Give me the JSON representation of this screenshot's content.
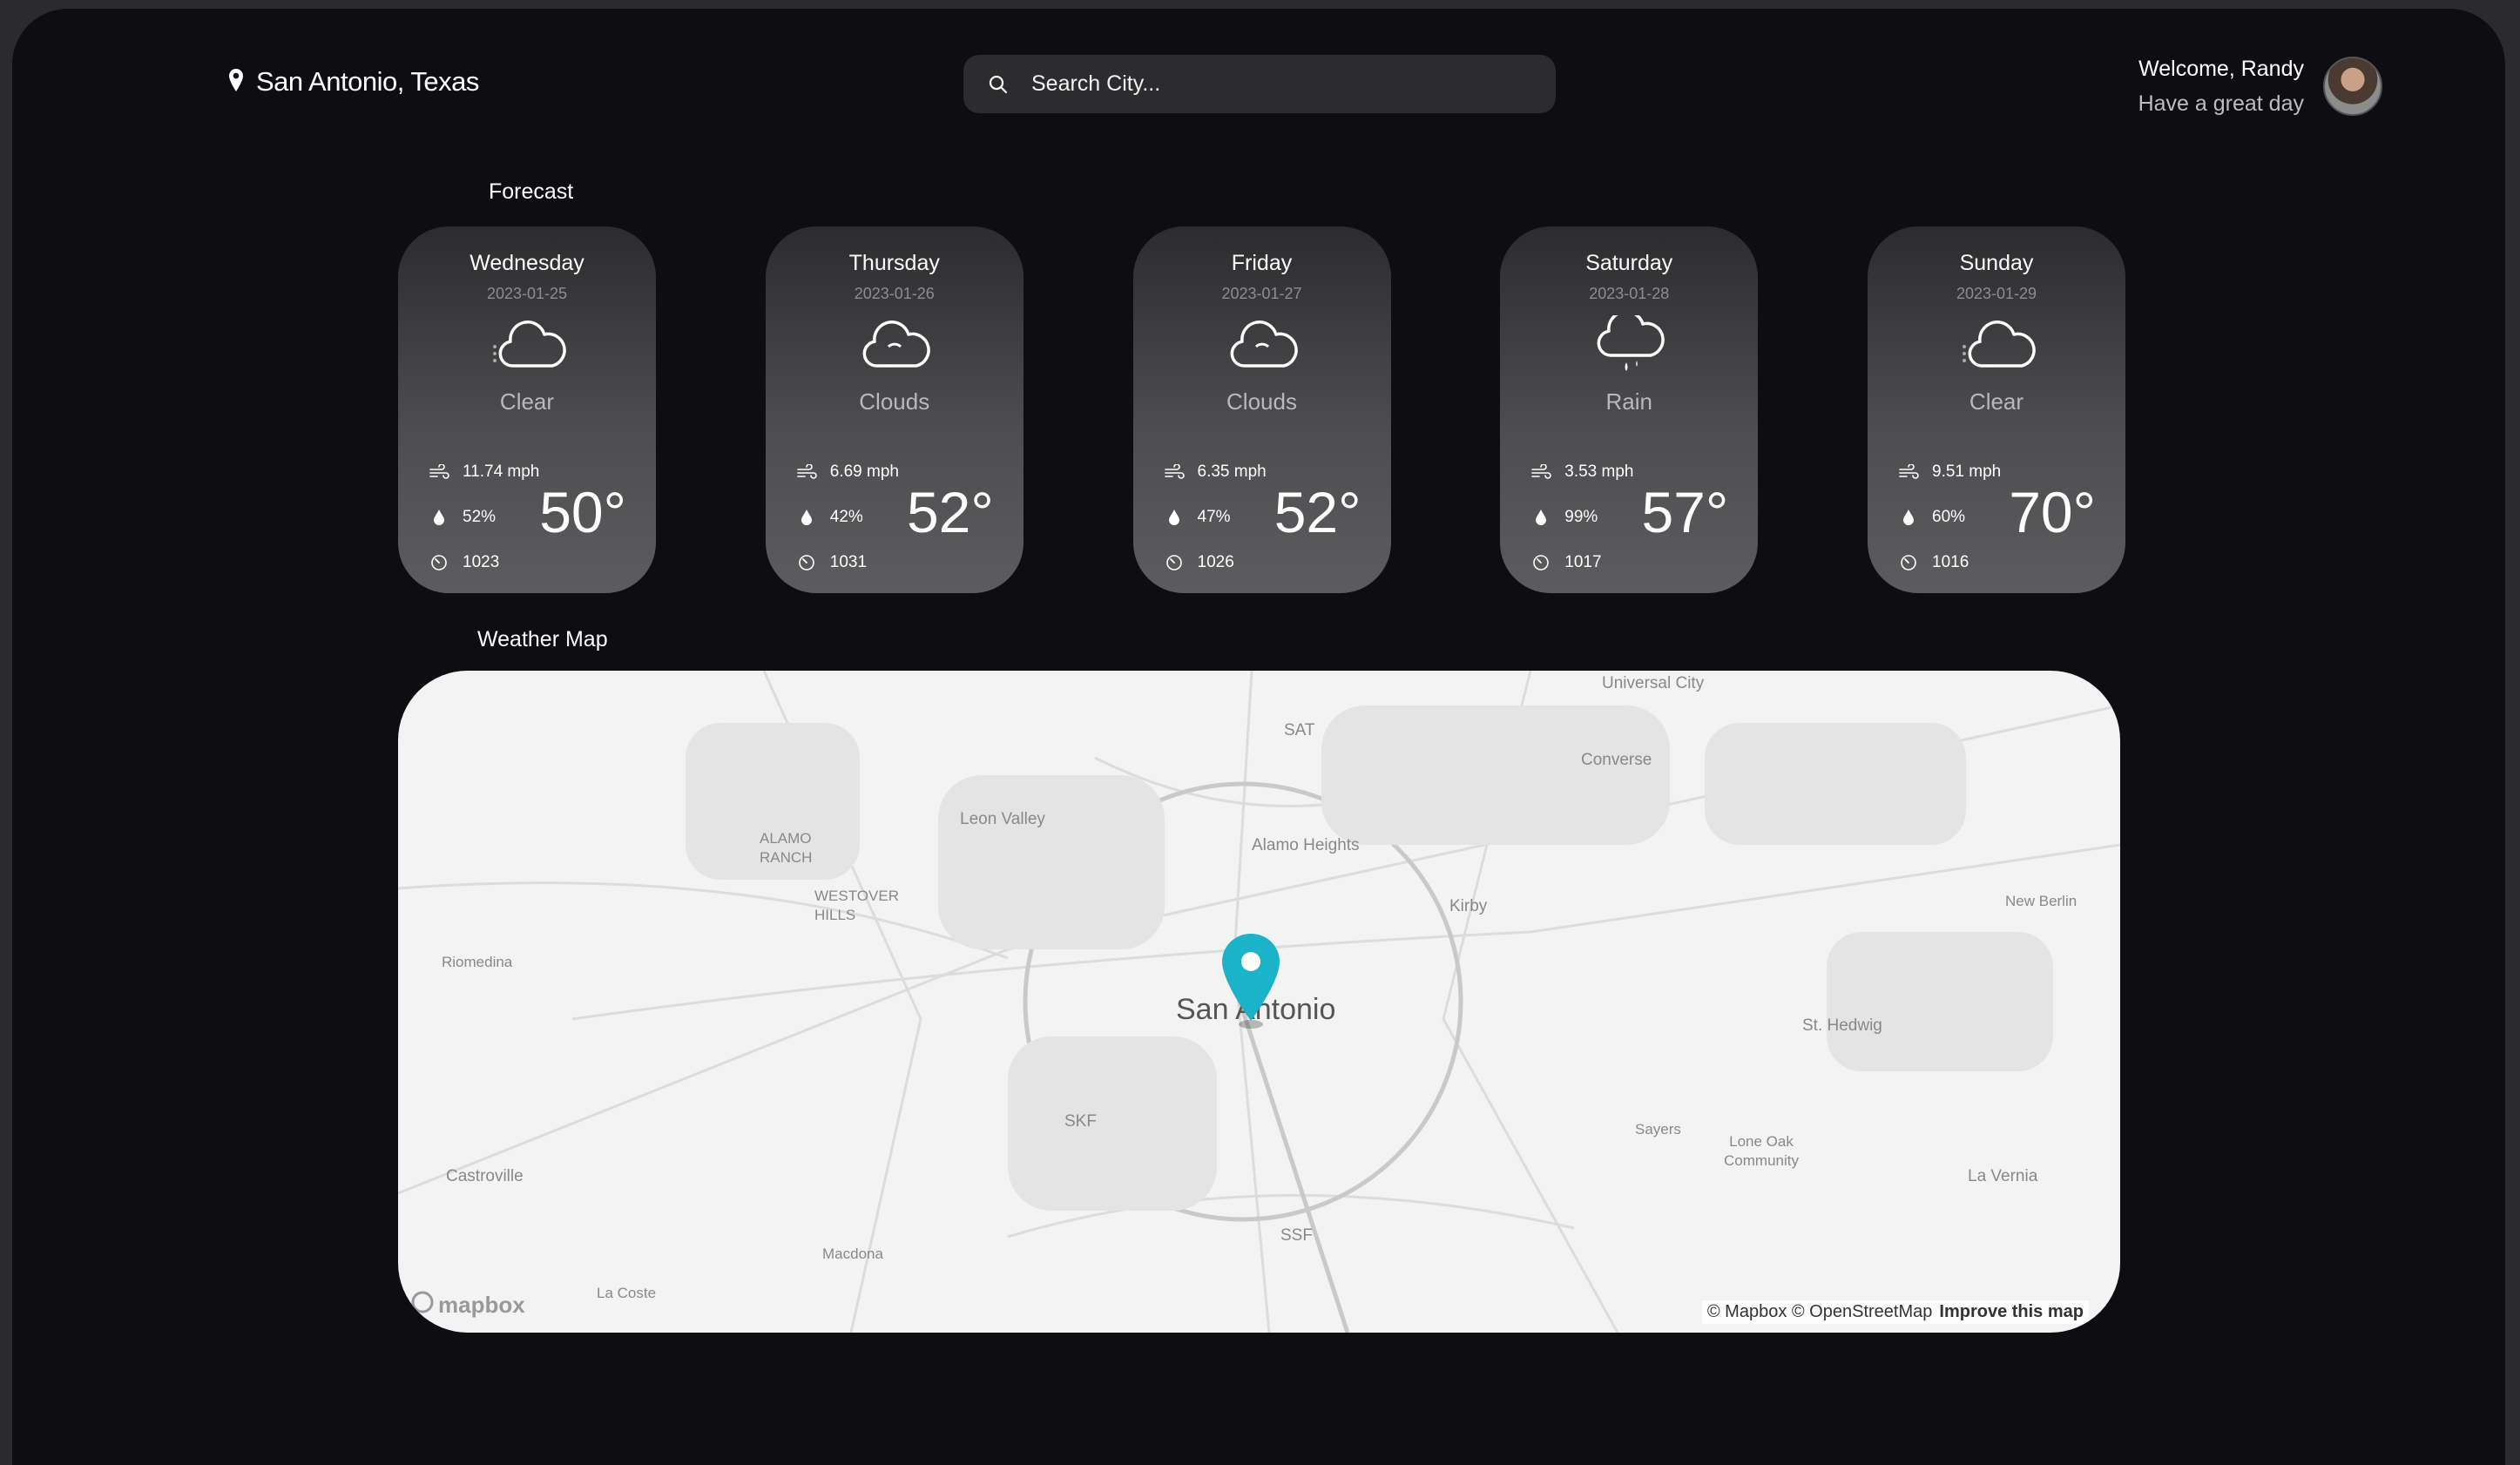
{
  "header": {
    "location": "San Antonio, Texas",
    "search_placeholder": "Search City...",
    "welcome": "Welcome, Randy",
    "subtitle": "Have a great day"
  },
  "sections": {
    "forecast": "Forecast",
    "map": "Weather Map"
  },
  "forecast": [
    {
      "day": "Wednesday",
      "date": "2023-01-25",
      "condition": "Clear",
      "icon": "cloud-partly-icon",
      "wind": "11.74 mph",
      "humidity": "52%",
      "pressure": "1023",
      "temp": "50°"
    },
    {
      "day": "Thursday",
      "date": "2023-01-26",
      "condition": "Clouds",
      "icon": "cloud-icon",
      "wind": "6.69 mph",
      "humidity": "42%",
      "pressure": "1031",
      "temp": "52°"
    },
    {
      "day": "Friday",
      "date": "2023-01-27",
      "condition": "Clouds",
      "icon": "cloud-icon",
      "wind": "6.35 mph",
      "humidity": "47%",
      "pressure": "1026",
      "temp": "52°"
    },
    {
      "day": "Saturday",
      "date": "2023-01-28",
      "condition": "Rain",
      "icon": "cloud-rain-icon",
      "wind": "3.53 mph",
      "humidity": "99%",
      "pressure": "1017",
      "temp": "57°"
    },
    {
      "day": "Sunday",
      "date": "2023-01-29",
      "condition": "Clear",
      "icon": "cloud-partly-icon",
      "wind": "9.51 mph",
      "humidity": "60%",
      "pressure": "1016",
      "temp": "70°"
    }
  ],
  "map": {
    "city_label": "San Antonio",
    "labels": [
      "Universal City",
      "SAT",
      "Converse",
      "Leon Valley",
      "ALAMO RANCH",
      "Alamo Heights",
      "WESTOVER HILLS",
      "Kirby",
      "New Berlin",
      "Riomedina",
      "St. Hedwig",
      "SKF",
      "Sayers",
      "Lone Oak Community",
      "Castroville",
      "La Vernia",
      "SSF",
      "Macdona",
      "La Coste"
    ],
    "logo": "mapbox",
    "attribution": "© Mapbox © OpenStreetMap",
    "improve": "Improve this map"
  }
}
